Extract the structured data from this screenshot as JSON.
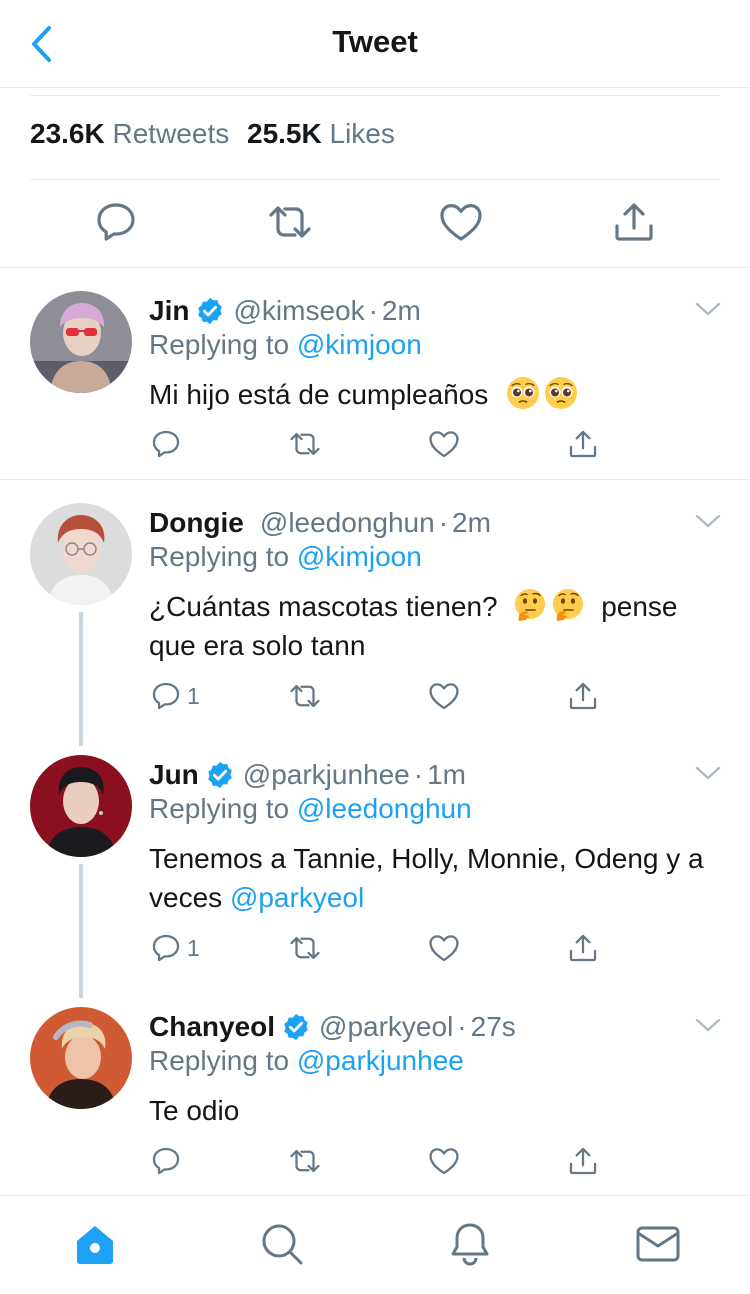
{
  "header": {
    "title": "Tweet",
    "back_icon": "chevron-left-icon"
  },
  "stats": {
    "retweets_count": "23.6K",
    "retweets_label": "Retweets",
    "likes_count": "25.5K",
    "likes_label": "Likes"
  },
  "main_actions": [
    "reply-icon",
    "retweet-icon",
    "like-icon",
    "share-icon"
  ],
  "colors": {
    "accent": "#1da1f2",
    "secondary_text": "#657786",
    "divider": "#e6ecf0",
    "verified": "#1da1f2"
  },
  "replies": [
    {
      "name": "Jin",
      "verified": true,
      "handle": "@kimseok",
      "separator": "·",
      "time": "2m",
      "replying_prefix": "Replying to",
      "replying_to": "@kimjoon",
      "text": "Mi hijo está de cumpleaños",
      "emoji": [
        "pleading-face",
        "pleading-face"
      ],
      "reply_count": ""
    },
    {
      "name": "Dongie",
      "verified": false,
      "handle": "@leedonghun",
      "separator": "·",
      "time": "2m",
      "replying_prefix": "Replying to",
      "replying_to": "@kimjoon",
      "text_a": "¿Cuántas mascotas tienen?",
      "emoji": [
        "thinking-face",
        "thinking-face"
      ],
      "text_b": "pense que era solo tann",
      "reply_count": "1"
    },
    {
      "name": "Jun",
      "verified": true,
      "handle": "@parkjunhee",
      "separator": "·",
      "time": "1m",
      "replying_prefix": "Replying to",
      "replying_to": "@leedonghun",
      "text": "Tenemos a Tannie, Holly, Monnie, Odeng y a veces",
      "mention": "@parkyeol",
      "reply_count": "1"
    },
    {
      "name": "Chanyeol",
      "verified": true,
      "handle": "@parkyeol",
      "separator": "·",
      "time": "27s",
      "replying_prefix": "Replying to",
      "replying_to": "@parkjunhee",
      "text": "Te odio",
      "reply_count": ""
    }
  ],
  "tabbar": [
    "home-icon",
    "search-icon",
    "notifications-icon",
    "messages-icon"
  ]
}
